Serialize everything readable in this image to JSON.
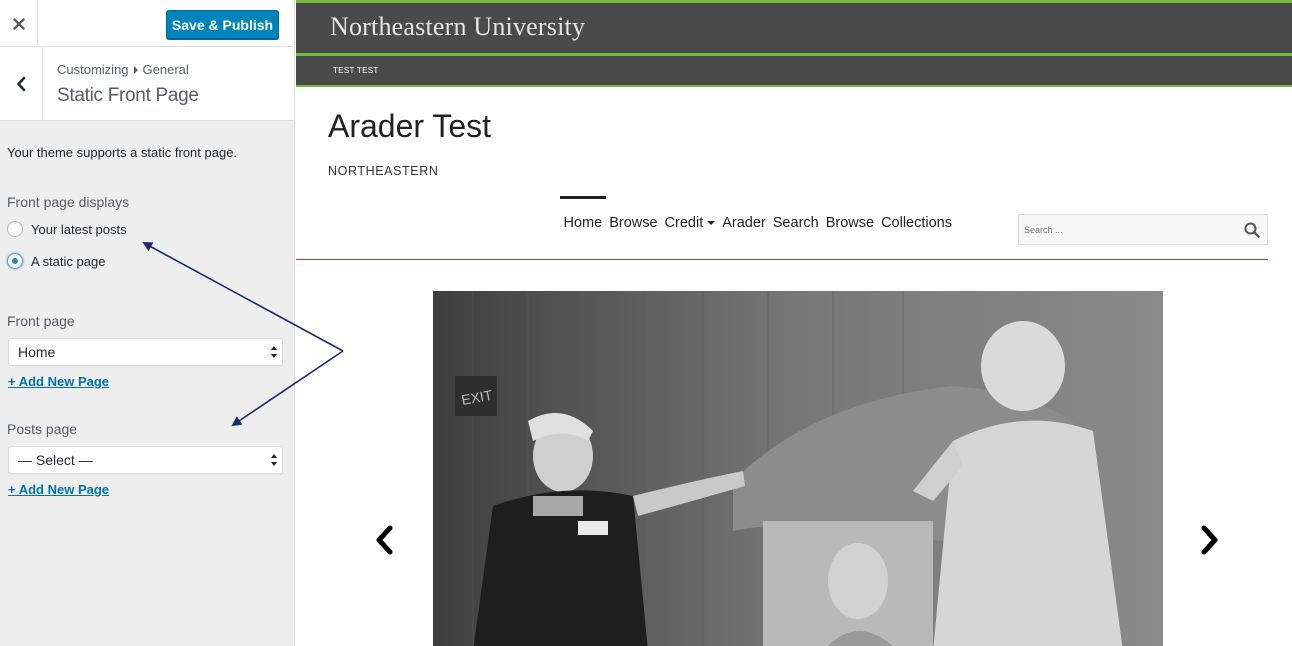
{
  "customizer": {
    "save_label": "Save & Publish",
    "breadcrumb_root": "Customizing",
    "breadcrumb_section": "General",
    "panel_title": "Static Front Page",
    "intro_text": "Your theme supports a static front page.",
    "front_page_displays_label": "Front page displays",
    "radio_options": [
      {
        "label": "Your latest posts",
        "checked": false
      },
      {
        "label": "A static page",
        "checked": true
      }
    ],
    "front_page_label": "Front page",
    "front_page_value": "Home",
    "posts_page_label": "Posts page",
    "posts_page_value": "— Select —",
    "add_new_page_label": "+ Add New Page",
    "accent_color": "#0085ba"
  },
  "site": {
    "university_name": "Northeastern University",
    "top_sub_label": "TEST TEST",
    "title": "Arader Test",
    "tagline": "NORTHEASTERN",
    "nav": [
      {
        "label": "Home",
        "active": true
      },
      {
        "label": "Browse"
      },
      {
        "label": "Credit",
        "has_dropdown": true
      },
      {
        "label": "Arader"
      },
      {
        "label": "Search"
      },
      {
        "label": "Browse"
      },
      {
        "label": "Collections"
      }
    ],
    "search_placeholder": "Search ...",
    "brand_bar_color": "#4a4a4a",
    "brand_accent_color": "#77b843",
    "nav_rule_color": "#c83232"
  },
  "slider": {
    "image_description": "black-and-white photograph",
    "prev_icon": "chevron-left-icon",
    "next_icon": "chevron-right-icon"
  },
  "annotations": {
    "arrow_color": "#1c2a6e"
  }
}
